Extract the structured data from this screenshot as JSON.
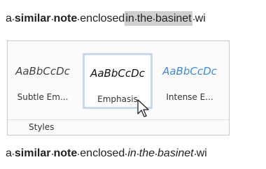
{
  "document": {
    "line_top": {
      "prefix": "a",
      "bold": "similar",
      "bold2": "note",
      "word1": "enclosed",
      "sel1": "in",
      "sel2": "the",
      "sel3": "basinet",
      "tail": "wi"
    },
    "line_bottom": {
      "prefix": "a",
      "bold": "similar",
      "bold2": "note",
      "word1": "enclosed",
      "ital1": "in",
      "ital2": "the",
      "ital3": "basinet",
      "tail": "wi"
    }
  },
  "styles_gallery": {
    "tiles": [
      {
        "sample": "AaBbCcDc",
        "name": "Subtle Em..."
      },
      {
        "sample": "AaBbCcDc",
        "name": "Emphasis"
      },
      {
        "sample": "AaBbCcDc",
        "name": "Intense E..."
      }
    ],
    "group_label": "Styles"
  },
  "icons": {
    "cursor": "mouse-pointer-icon"
  },
  "colors": {
    "selection": "#cfcfcf",
    "hover_border": "#c5d9ef",
    "intense_text": "#3c8bd9"
  }
}
